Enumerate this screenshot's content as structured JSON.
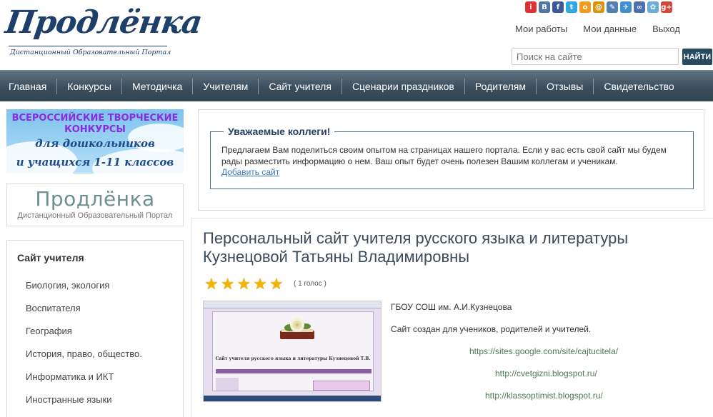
{
  "logo": {
    "title": "Продлёнка",
    "subtitle": "Дистанционный Образовательный Портал"
  },
  "social_icons": [
    {
      "name": "man-icon",
      "glyph": "i",
      "color": "#e03030"
    },
    {
      "name": "vkontakte-icon",
      "glyph": "В",
      "color": "#4c75a3"
    },
    {
      "name": "facebook-icon",
      "glyph": "f",
      "color": "#3b5998"
    },
    {
      "name": "twitter-icon",
      "glyph": "t",
      "color": "#2fa8e8"
    },
    {
      "name": "odnoklassniki-icon",
      "glyph": "о",
      "color": "#f39a1d"
    },
    {
      "name": "mailru-icon",
      "glyph": "@",
      "color": "#d7940e"
    },
    {
      "name": "pen-icon",
      "glyph": "✎",
      "color": "#4f7fb3"
    },
    {
      "name": "livejournal-icon",
      "glyph": "✈",
      "color": "#3f8fd1"
    },
    {
      "name": "liveinternet-icon",
      "glyph": "∞",
      "color": "#4b6fb5"
    },
    {
      "name": "bookmark-icon",
      "glyph": "✿",
      "color": "#6aaed8"
    },
    {
      "name": "googleplus-icon",
      "glyph": "g+",
      "color": "#d34836"
    }
  ],
  "user_links": [
    "Мои работы",
    "Мои данные",
    "Выход"
  ],
  "search": {
    "placeholder": "Поиск на сайте",
    "button": "НАЙТИ"
  },
  "nav": [
    "Главная",
    "Конкурсы",
    "Методичка",
    "Учителям",
    "Сайт учителя",
    "Сценарии праздников",
    "Родителям",
    "Отзывы",
    "Свидетельство"
  ],
  "banner": {
    "line1": "ВСЕРОССИЙСКИЕ ТВОРЧЕСКИЕ",
    "line1b": "КОНКУРСЫ",
    "line2": "для дошкольников",
    "line3": "и учащихся 1-11 классов"
  },
  "side_logo": {
    "title": "Продлёнка",
    "subtitle": "Дистанционный Образовательный Портал"
  },
  "categories": {
    "title": "Сайт учителя",
    "items": [
      "Биология, экология",
      "Воспитателя",
      "География",
      "История, право, общество.",
      "Информатика и ИКТ",
      "Иностранные языки"
    ]
  },
  "notice": {
    "title": "Уважаемые коллеги!",
    "text": "Предлагаем Вам поделиться своим опытом на страницах нашего портала. Если у вас есть свой сайт мы будем рады разместить информацию о нем. Ваш опыт будет очень полезен Вашим коллегам и ученикам.",
    "link": "Добавить сайт"
  },
  "article": {
    "title": "Персональный сайт учителя русского языка и литературы Кузнецовой Татьяны Владимировны",
    "rating": 5,
    "votes": "( 1 голос )",
    "thumbnail_title": "Сайт учителя русского языка и литературы Кузнецовой Т.В.",
    "school": "ГБОУ СОШ им. А.И.Кузнецова",
    "description": "Сайт создан для учеников, родителей и учителей.",
    "links": [
      "https://sites.google.com/site/cajtucitela/",
      "http://cvetgizni.blogspot.ru/",
      "http://klassoptimist.blogspot.ru/"
    ]
  }
}
